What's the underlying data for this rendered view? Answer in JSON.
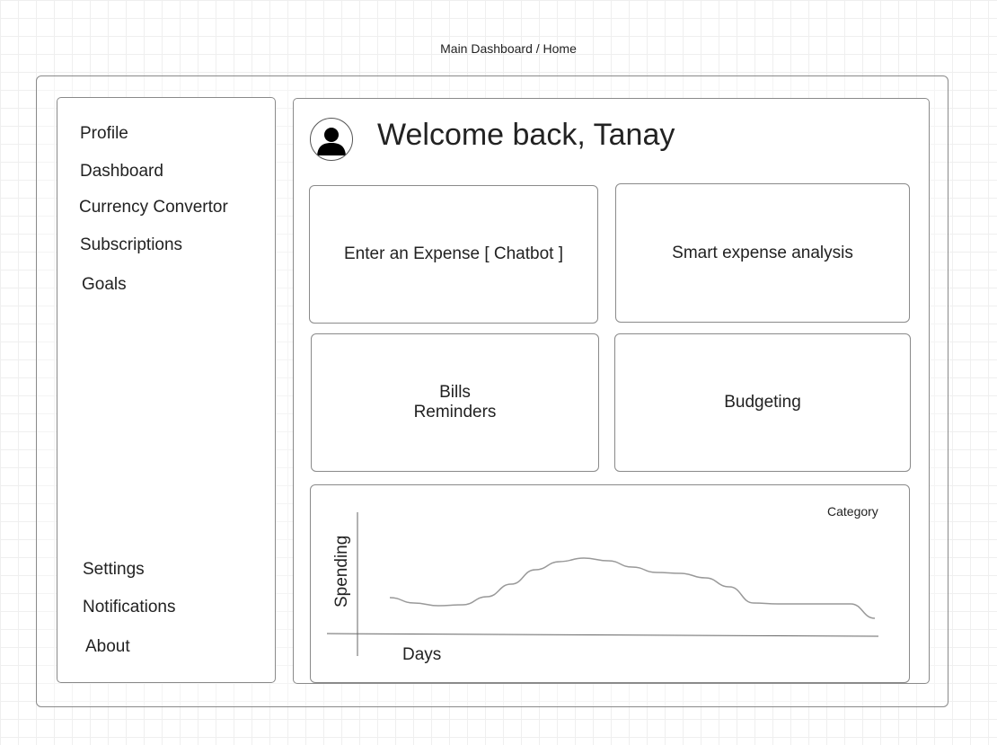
{
  "page_title": "Main Dashboard / Home",
  "sidebar": {
    "top_items": [
      {
        "label": "Profile"
      },
      {
        "label": "Dashboard"
      },
      {
        "label": "Currency Convertor"
      },
      {
        "label": "Subscriptions"
      },
      {
        "label": "Goals"
      }
    ],
    "bottom_items": [
      {
        "label": "Settings"
      },
      {
        "label": "Notifications"
      },
      {
        "label": "About"
      }
    ]
  },
  "header": {
    "welcome_text": "Welcome back, Tanay",
    "avatar_icon": "user-avatar-icon"
  },
  "cards": {
    "expense_chatbot": {
      "label": "Enter an Expense [ Chatbot ]"
    },
    "smart_analysis": {
      "label": "Smart expense analysis"
    },
    "bills_reminders": {
      "line1": "Bills",
      "line2": "Reminders"
    },
    "budgeting": {
      "label": "Budgeting"
    }
  },
  "chart_data": {
    "type": "line",
    "title": "",
    "xlabel": "Days",
    "ylabel": "Spending",
    "legend": [
      "Category"
    ],
    "legend_position": "top-right",
    "grid": false,
    "series": [
      {
        "name": "Category",
        "x": [
          0,
          5,
          10,
          15,
          20,
          25,
          30,
          35,
          40,
          45,
          50,
          55,
          60,
          65,
          70,
          75,
          80,
          85,
          90,
          95,
          100
        ],
        "y": [
          0.35,
          0.29,
          0.26,
          0.27,
          0.36,
          0.5,
          0.66,
          0.75,
          0.79,
          0.76,
          0.69,
          0.63,
          0.62,
          0.57,
          0.47,
          0.29,
          0.28,
          0.28,
          0.28,
          0.28,
          0.12
        ]
      }
    ],
    "xlim": [
      0,
      100
    ],
    "ylim": [
      0,
      1
    ]
  }
}
